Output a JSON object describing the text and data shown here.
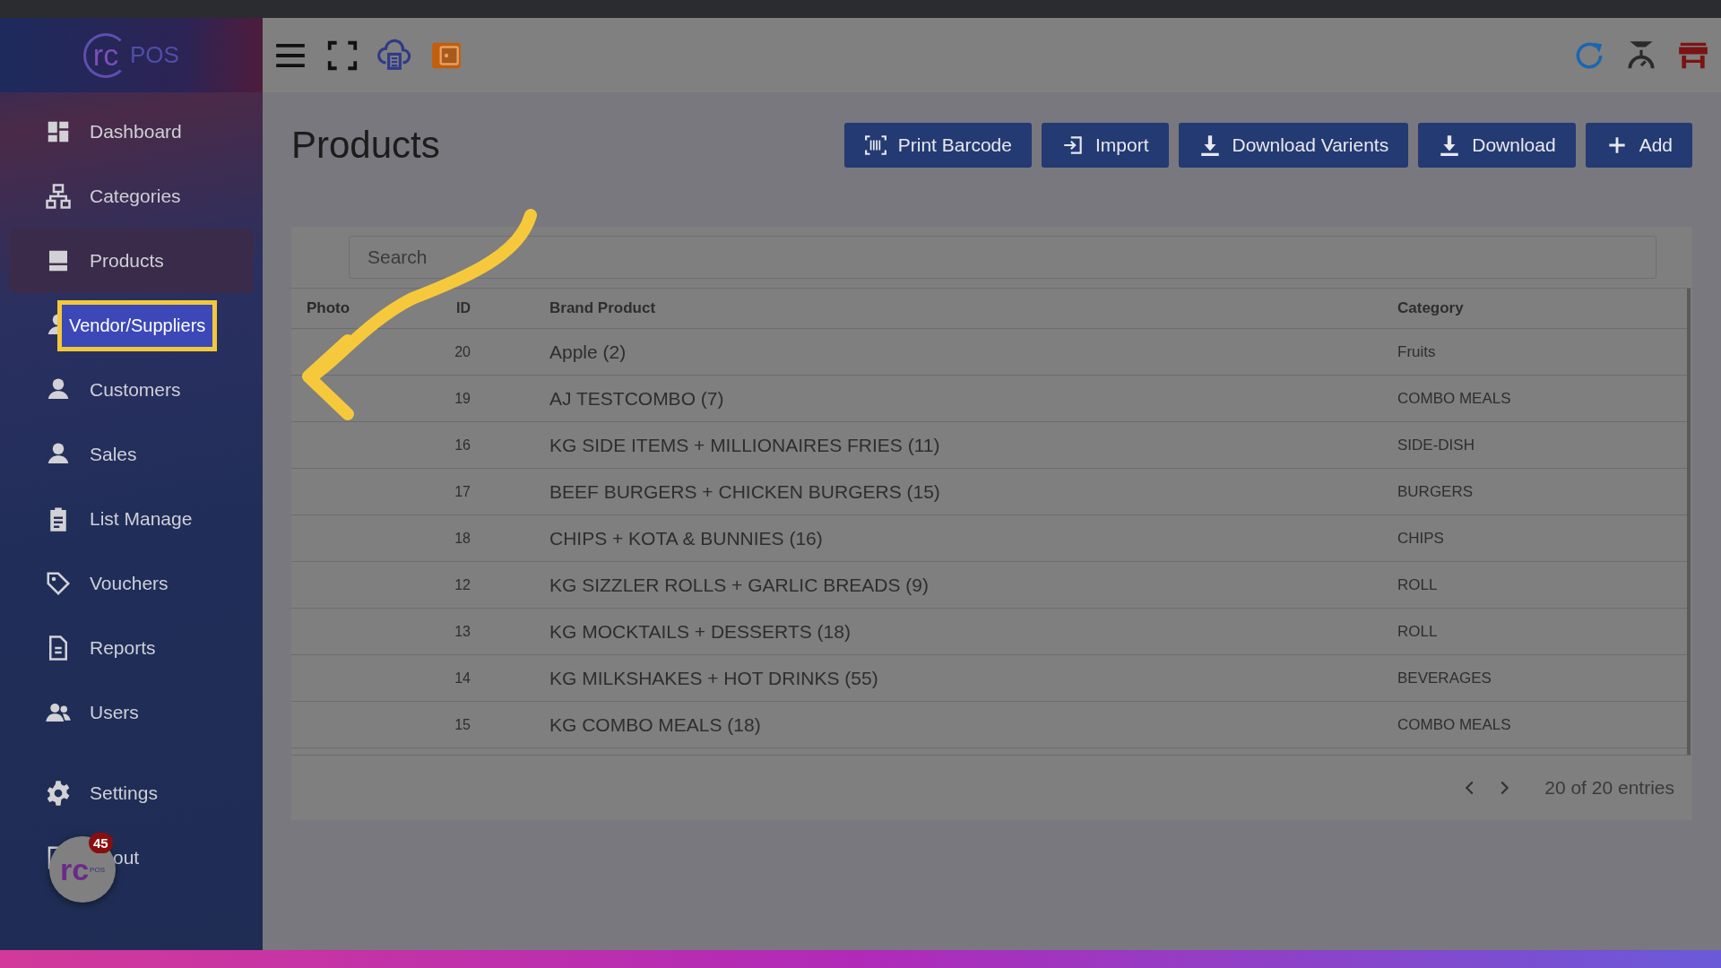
{
  "sidebar": {
    "logo": {
      "mark": "rc",
      "name": "POS"
    },
    "items": [
      {
        "label": "Dashboard",
        "selected": false,
        "highlighted": false
      },
      {
        "label": "Categories",
        "selected": false,
        "highlighted": false
      },
      {
        "label": "Products",
        "selected": true,
        "highlighted": false
      },
      {
        "label": "Vendor/Suppliers",
        "selected": false,
        "highlighted": true
      },
      {
        "label": "Customers",
        "selected": false,
        "highlighted": false
      },
      {
        "label": "Sales",
        "selected": false,
        "highlighted": false
      },
      {
        "label": "List Manage",
        "selected": false,
        "highlighted": false
      },
      {
        "label": "Vouchers",
        "selected": false,
        "highlighted": false
      },
      {
        "label": "Reports",
        "selected": false,
        "highlighted": false
      },
      {
        "label": "Users",
        "selected": false,
        "highlighted": false
      }
    ],
    "bottom_items": [
      {
        "label": "Settings"
      },
      {
        "label": "out"
      }
    ]
  },
  "page": {
    "title": "Products",
    "buttons": [
      "Print Barcode",
      "Import",
      "Download Varients",
      "Download",
      "Add"
    ]
  },
  "table": {
    "search": {
      "placeholder": "Search"
    },
    "columns": [
      "Photo",
      "ID",
      "Brand Product",
      "Category"
    ],
    "rows": [
      {
        "id": "20",
        "product": "Apple (2)",
        "category": "Fruits"
      },
      {
        "id": "19",
        "product": "AJ TESTCOMBO (7)",
        "category": "COMBO MEALS"
      },
      {
        "id": "16",
        "product": "KG SIDE ITEMS + MILLIONAIRES FRIES (11)",
        "category": "SIDE-DISH"
      },
      {
        "id": "17",
        "product": "BEEF BURGERS + CHICKEN BURGERS (15)",
        "category": "BURGERS"
      },
      {
        "id": "18",
        "product": "CHIPS + KOTA & BUNNIES (16)",
        "category": "CHIPS"
      },
      {
        "id": "12",
        "product": "KG SIZZLER ROLLS + GARLIC BREADS (9)",
        "category": "ROLL"
      },
      {
        "id": "13",
        "product": "KG MOCKTAILS + DESSERTS (18)",
        "category": "ROLL"
      },
      {
        "id": "14",
        "product": "KG MILKSHAKES + HOT DRINKS (55)",
        "category": "BEVERAGES"
      },
      {
        "id": "15",
        "product": "KG COMBO MEALS (18)",
        "category": "COMBO MEALS"
      }
    ],
    "pagination": "20 of 20 entries"
  },
  "chat_widget": {
    "mark": "rc",
    "sub": "POS",
    "badge": "45"
  }
}
